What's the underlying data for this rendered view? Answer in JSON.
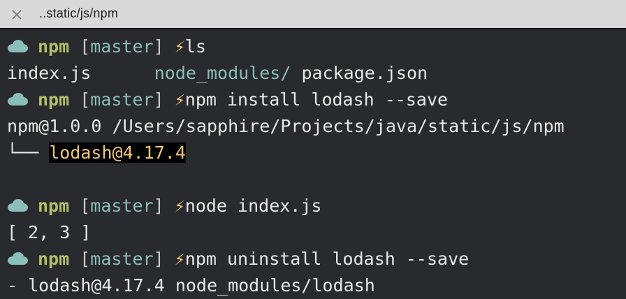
{
  "window": {
    "tab_title": "..static/js/npm",
    "close_icon": "close-icon"
  },
  "prompt": {
    "npm": "npm",
    "branch": "master",
    "bolt": "⚡",
    "icon": "cloud-icon"
  },
  "lines": {
    "cmd1": "ls",
    "ls_files": [
      "index.js",
      "node_modules/",
      "package.json"
    ],
    "cmd2": "npm install lodash --save",
    "install_path": "npm@1.0.0 /Users/sapphire/Projects/java/static/js/npm",
    "tree_prefix": "└── ",
    "installed_pkg": "lodash@4.17.4",
    "cmd3": "node index.js",
    "node_output": "[ 2, 3 ]",
    "cmd4": "npm uninstall lodash --save",
    "uninstall_output": "- lodash@4.17.4 node_modules/lodash"
  },
  "colors": {
    "background": "#282a2e",
    "prompt_green": "#b5bd68",
    "branch_cyan": "#8abeb7",
    "bolt_yellow": "#f0c674",
    "text": "#e8e8e8"
  }
}
